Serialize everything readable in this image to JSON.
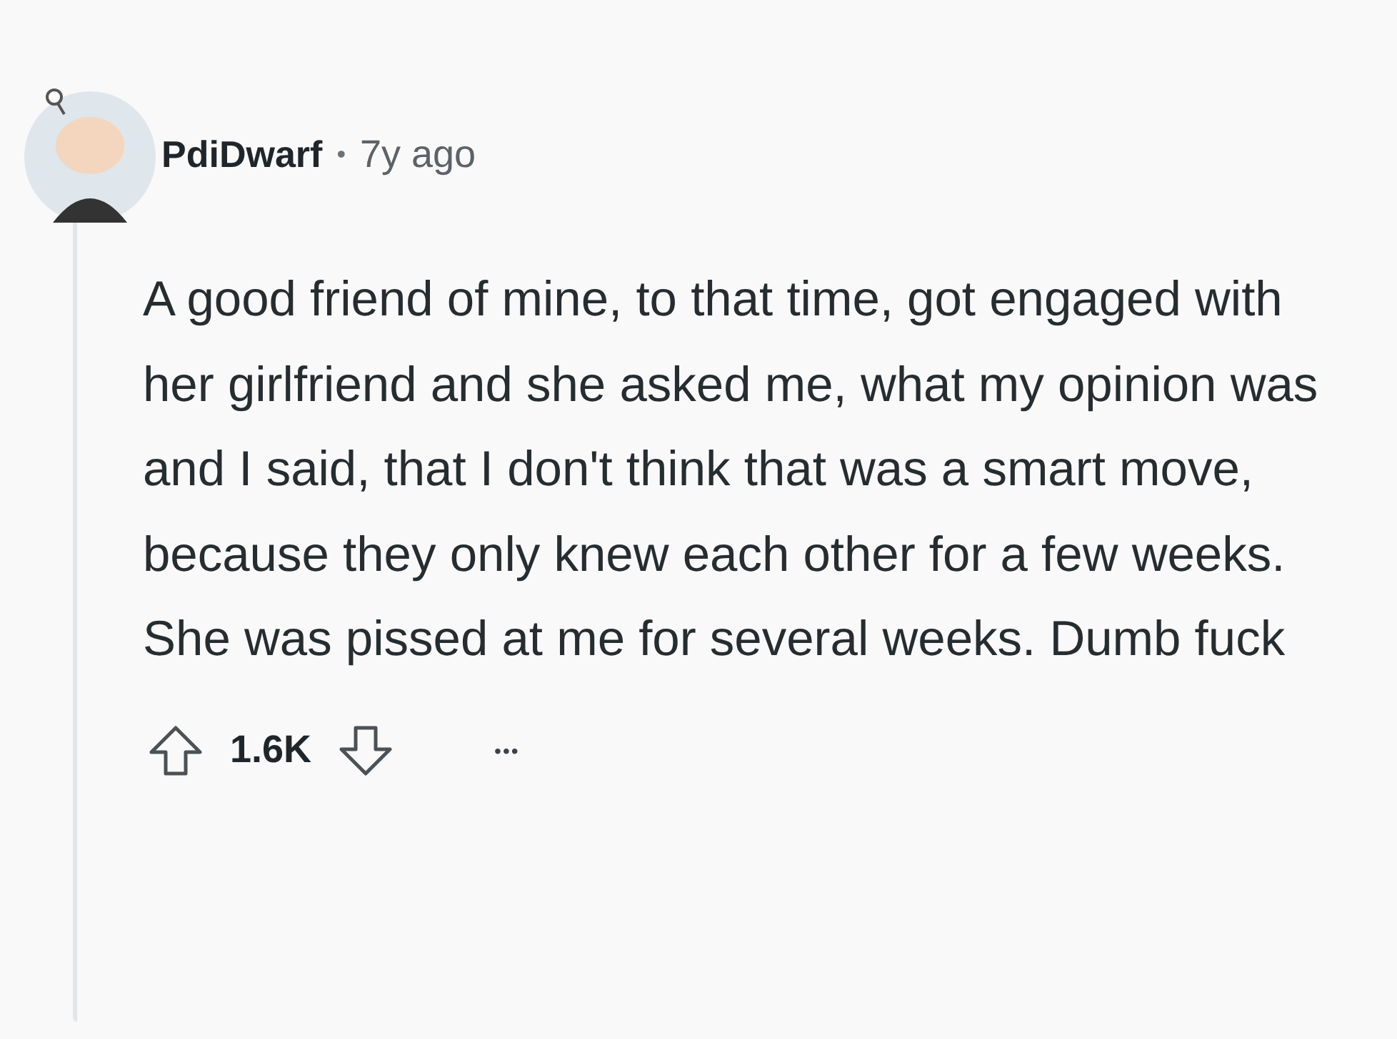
{
  "comment": {
    "author": "PdiDwarf",
    "separator": "•",
    "age": "7y ago",
    "body": "A good friend of mine, to that time, got engaged with her girlfriend and she asked me, what my opinion was and I said, that I don't think that was a smart move, because they only knew each other for a few weeks. She was pissed at me for several weeks. Dumb fuck",
    "votes": "1.6K",
    "more": "•••"
  }
}
